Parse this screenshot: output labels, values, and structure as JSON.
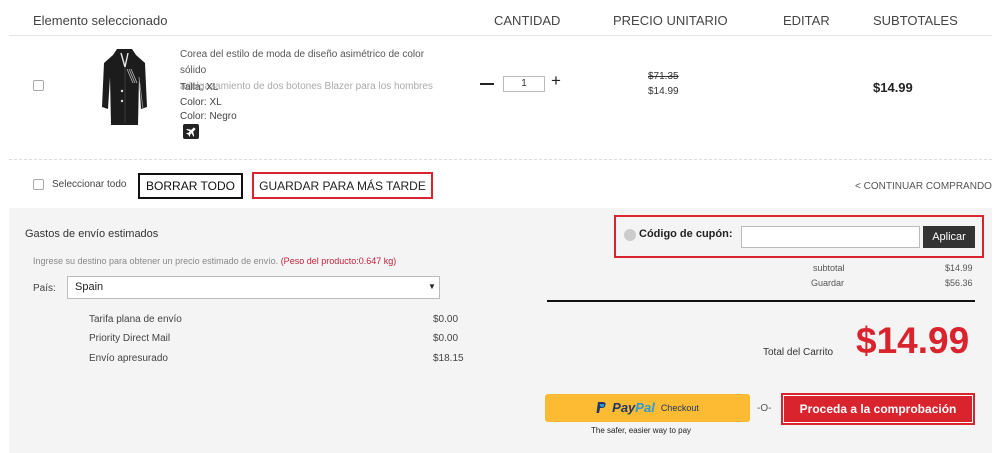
{
  "header": {
    "selected_item": "Elemento seleccionado",
    "quantity": "CANTIDAD",
    "unit_price": "PRECIO UNITARIO",
    "edit": "EDITAR",
    "subtotals": "SUBTOTALES"
  },
  "item": {
    "title_line1": "Corea del estilo de moda de diseño asimétrico de color sólido",
    "title_line2": "adelgazamiento de dos botones Blazer para los hombres",
    "size": "Talla: XL",
    "color_1": "Color: XL",
    "color_2": "Color: Negro",
    "image_icon": "black-blazer-image",
    "shipping_icon": "airplane-icon",
    "quantity": "1",
    "minus_symbol": "—",
    "plus_symbol": "+",
    "old_price": "$71.35",
    "price": "$14.99",
    "subtotal": "$14.99"
  },
  "actions": {
    "select_all": "Seleccionar todo",
    "delete_all": "BORRAR TODO",
    "save_later": "GUARDAR PARA MÁS TARDE",
    "continue_shopping": "< CONTINUAR COMPRANDO"
  },
  "shipping": {
    "title": "Gastos de envío estimados",
    "hint": "Ingrese su destino para obtener un precio estimado de envío.",
    "weight_note": "(Peso del producto:0.647 kg)",
    "country_label": "País:",
    "country_value": "Spain",
    "options": [
      {
        "name": "Tarifa plana de envío",
        "price": "$0.00"
      },
      {
        "name": "Priority Direct Mail",
        "price": "$0.00"
      },
      {
        "name": "Envío apresurado",
        "price": "$18.15"
      }
    ]
  },
  "coupon": {
    "label": "Código de cupón:",
    "value": "",
    "apply": "Aplicar"
  },
  "summary": {
    "subtotal_label": "subtotal",
    "subtotal_value": "$14.99",
    "save_label": "Guardar",
    "save_value": "$56.36",
    "total_label": "Total del Carrito",
    "total_value": "$14.99"
  },
  "checkout": {
    "paypal_pay": "Pay",
    "paypal_pal": "Pal",
    "paypal_checkout": "Checkout",
    "paypal_note": "The safer, easier way to pay",
    "or": "-O-",
    "proceed": "Proceda a la comprobación"
  },
  "colors": {
    "accent_red": "#d9232d",
    "paypal_yellow": "#fcbb32",
    "paypal_navy": "#1e3768",
    "paypal_blue": "#2b9bd8"
  }
}
